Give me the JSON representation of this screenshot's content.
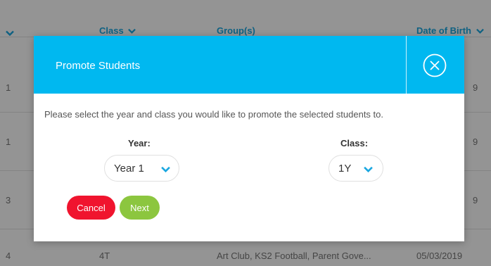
{
  "table": {
    "headers": {
      "class": "Class",
      "groups": "Group(s)",
      "dob": "Date of Birth"
    },
    "rows": [
      {
        "first": "1",
        "class": "",
        "groups": "",
        "dob": "9"
      },
      {
        "first": "1",
        "class": "",
        "groups": "",
        "dob": "9"
      },
      {
        "first": "3",
        "class": "",
        "groups": "",
        "dob": "9"
      },
      {
        "first": "4",
        "class": "4T",
        "groups": "Art Club, KS2 Football, Parent Gove...",
        "dob": "05/03/2019"
      }
    ]
  },
  "modal": {
    "title": "Promote Students",
    "instructions": "Please select the year and class you would like to promote the selected students to.",
    "year": {
      "label": "Year:",
      "value": "Year 1"
    },
    "class": {
      "label": "Class:",
      "value": "1Y"
    },
    "buttons": {
      "cancel": "Cancel",
      "next": "Next"
    }
  },
  "colors": {
    "header": "#00b8f0",
    "cancel": "#f0142e",
    "next": "#8cc63f",
    "accent": "#1aa7e0"
  },
  "icons": {
    "close": "close-circle-icon",
    "dropdown": "chevron-down-icon"
  }
}
